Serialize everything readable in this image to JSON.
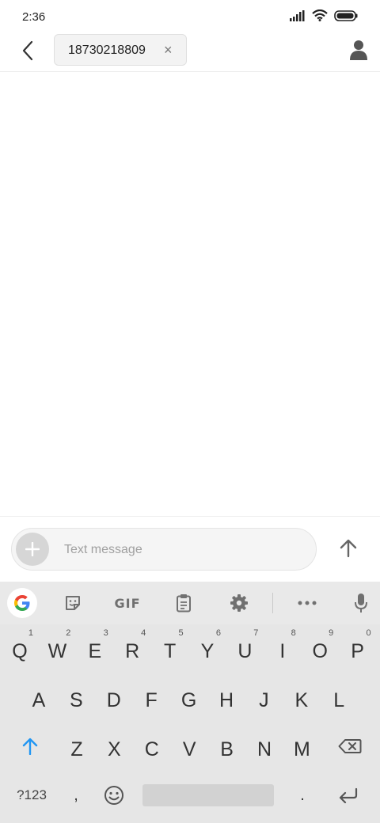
{
  "status_bar": {
    "time": "2:36"
  },
  "header": {
    "recipient_number": "18730218809",
    "remove_symbol": "×"
  },
  "compose": {
    "placeholder": "Text message"
  },
  "keyboard": {
    "toolbar": {
      "gif_label": "GIF"
    },
    "rows": [
      [
        {
          "label": "Q",
          "hint": "1"
        },
        {
          "label": "W",
          "hint": "2"
        },
        {
          "label": "E",
          "hint": "3"
        },
        {
          "label": "R",
          "hint": "4"
        },
        {
          "label": "T",
          "hint": "5"
        },
        {
          "label": "Y",
          "hint": "6"
        },
        {
          "label": "U",
          "hint": "7"
        },
        {
          "label": "I",
          "hint": "8"
        },
        {
          "label": "O",
          "hint": "9"
        },
        {
          "label": "P",
          "hint": "0"
        }
      ],
      [
        {
          "label": "A"
        },
        {
          "label": "S"
        },
        {
          "label": "D"
        },
        {
          "label": "F"
        },
        {
          "label": "G"
        },
        {
          "label": "H"
        },
        {
          "label": "J"
        },
        {
          "label": "K"
        },
        {
          "label": "L"
        }
      ],
      [
        {
          "label": "Z"
        },
        {
          "label": "X"
        },
        {
          "label": "C"
        },
        {
          "label": "V"
        },
        {
          "label": "B"
        },
        {
          "label": "N"
        },
        {
          "label": "M"
        }
      ]
    ],
    "symbols_label": "?123",
    "comma_label": ",",
    "period_label": "."
  },
  "colors": {
    "shift_accent": "#2196f3",
    "keyboard_bg": "#e6e6e6"
  }
}
